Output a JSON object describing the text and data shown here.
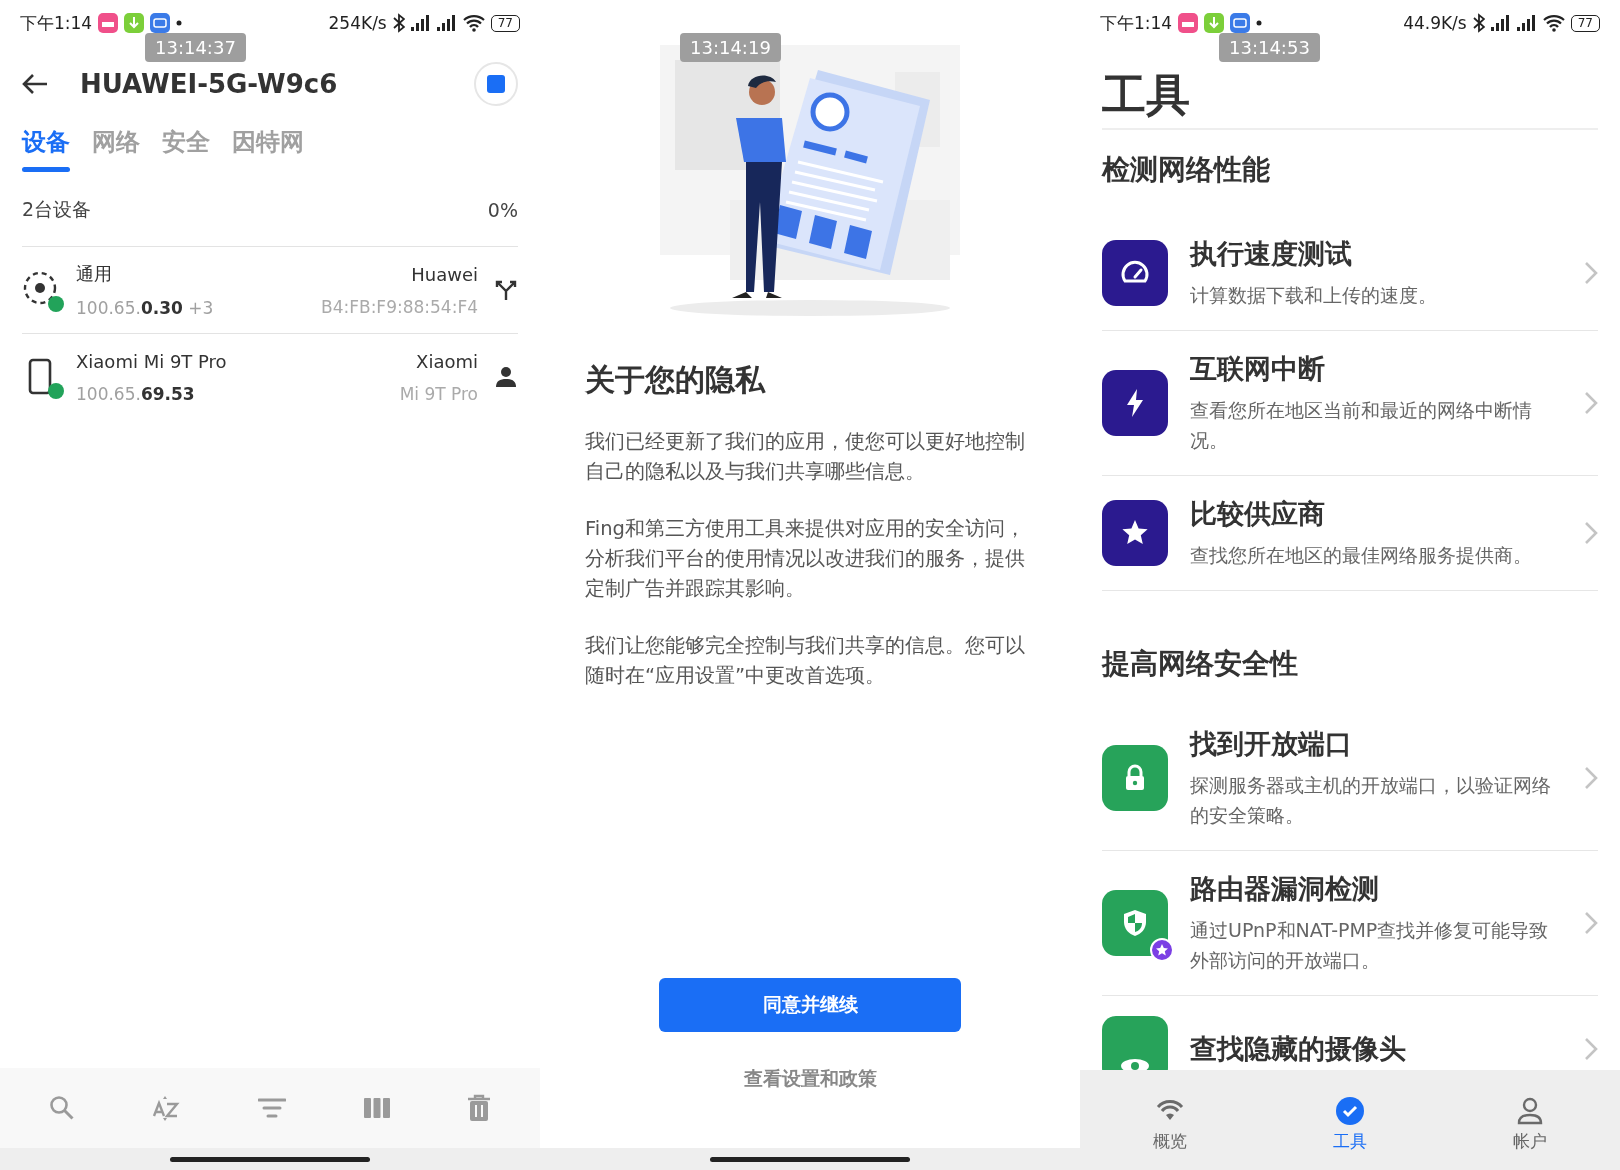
{
  "device_screen": {
    "status_bar": {
      "time": "下午1:14",
      "speed": "254K/s",
      "battery": "77"
    },
    "timestamp": "13:14:37",
    "title": "HUAWEI-5G-W9c6",
    "tabs": [
      {
        "label": "设备",
        "selected": true
      },
      {
        "label": "网络",
        "selected": false
      },
      {
        "label": "安全",
        "selected": false
      },
      {
        "label": "因特网",
        "selected": false
      }
    ],
    "summary": {
      "count": "2台设备",
      "percent": "0%"
    },
    "devices": [
      {
        "kind": "router",
        "name": "通用",
        "vendor": "Huawei",
        "address": "100.65.**0.30** +3",
        "detail": "B4:FB:F9:88:54:F4",
        "online": true
      },
      {
        "kind": "phone",
        "name": "Xiaomi Mi 9T Pro",
        "vendor": "Xiaomi",
        "address": "100.65.**69.53**",
        "detail": "Mi 9T Pro",
        "online": true
      }
    ]
  },
  "privacy_screen": {
    "timestamp": "13:14:19",
    "heading": "关于您的隐私",
    "paragraphs": [
      "我们已经更新了我们的应用，使您可以更好地控制自己的隐私以及与我们共享哪些信息。",
      "Fing和第三方使用工具来提供对应用的安全访问，分析我们平台的使用情况以改进我们的服务，提供定制广告并跟踪其影响。",
      "我们让您能够完全控制与我们共享的信息。您可以随时在“应用设置”中更改首选项。"
    ],
    "primary_button": "同意并继续",
    "secondary_link": "查看设置和政策"
  },
  "tools_screen": {
    "status_bar": {
      "time": "下午1:14",
      "speed": "44.9K/s",
      "battery": "77"
    },
    "timestamp": "13:14:53",
    "title": "工具",
    "sections": [
      {
        "title": "检测网络性能",
        "tools": [
          {
            "kind": "speed",
            "color": "#2b1a8f",
            "title": "执行速度测试",
            "description": "计算数据下载和上传的速度。",
            "premium": false
          },
          {
            "kind": "outage",
            "color": "#2b1a8f",
            "title": "互联网中断",
            "description": "查看您所在地区当前和最近的网络中断情况。",
            "premium": false
          },
          {
            "kind": "compare",
            "color": "#2b1a8f",
            "title": "比较供应商",
            "description": "查找您所在地区的最佳网络服务提供商。",
            "premium": false
          }
        ]
      },
      {
        "title": "提高网络安全性",
        "tools": [
          {
            "kind": "lock",
            "color": "#27a35a",
            "title": "找到开放端口",
            "description": "探测服务器或主机的开放端口，以验证网络的安全策略。",
            "premium": false
          },
          {
            "kind": "shield",
            "color": "#27a35a",
            "title": "路由器漏洞检测",
            "description": "通过UPnP和NAT-PMP查找并修复可能导致外部访问的开放端口。",
            "premium": true
          },
          {
            "kind": "camera",
            "color": "#27a35a",
            "title": "查找隐藏的摄像头",
            "premium": false
          }
        ]
      }
    ],
    "nav": [
      {
        "kind": "wifi",
        "label": "概览",
        "selected": false
      },
      {
        "kind": "check",
        "label": "工具",
        "selected": true
      },
      {
        "kind": "person",
        "label": "帐户",
        "selected": false
      }
    ]
  }
}
